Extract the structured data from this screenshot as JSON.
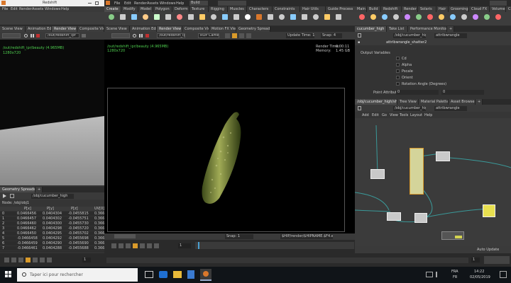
{
  "left_window": {
    "title": "Redshift",
    "menu": [
      "File",
      "Edit",
      "Render",
      "Assets",
      "Windows",
      "Help"
    ],
    "tabs": [
      "Scene View",
      "Animation Editor",
      "Render View",
      "Composite View"
    ],
    "path": "/out/redshift_ipr",
    "viewport_label": "/out/redshift_ipr/beauty (4.965MB)",
    "viewport_sub": "1280x720",
    "spreadsheet_tabs": [
      "Geometry Spreadsheet",
      "+"
    ],
    "spreadsheet_path": "/obj/cucumber_high",
    "node_label": "Node: /obj/obj1",
    "columns": [
      "",
      "P[x]",
      "P[y]",
      "P[z]",
      "UV[0]"
    ],
    "rows": [
      [
        "0",
        "0.0466456",
        "0.0404304",
        "-0.0455815",
        "0.366"
      ],
      [
        "1",
        "0.0466457",
        "0.0404302",
        "-0.0455751",
        "0.366"
      ],
      [
        "2",
        "0.0466460",
        "0.0404300",
        "-0.0455730",
        "0.366"
      ],
      [
        "3",
        "0.0466462",
        "0.0404298",
        "-0.0455720",
        "0.366"
      ],
      [
        "4",
        "0.0466450",
        "0.0404295",
        "-0.0455702",
        "0.366"
      ],
      [
        "5",
        "-0.0466458",
        "0.0404292",
        "-0.0455698",
        "0.366"
      ],
      [
        "6",
        "-0.0466459",
        "0.0404290",
        "-0.0455690",
        "0.366"
      ],
      [
        "7",
        "-0.0466461",
        "0.0404288",
        "-0.0455688",
        "0.366"
      ]
    ],
    "timeline_start": "1",
    "timeline_end": "1"
  },
  "center": {
    "menu": [
      "File",
      "Edit",
      "Render",
      "Assets",
      "Windows",
      "Help"
    ],
    "build_label": "Build",
    "shelf_tabs": [
      "Create",
      "Modify",
      "Model",
      "Polygon",
      "Deform",
      "Texture",
      "Rigging",
      "Muscles",
      "Characters",
      "Constraints",
      "Hair Utils",
      "Guide Process",
      "Terrain FX",
      "Cloud FX",
      "Volume"
    ],
    "tabs": [
      "Scene View",
      "Animation Editor",
      "Render View",
      "Composite View",
      "Motion FX View",
      "Geometry Spreadsheet"
    ],
    "path": "/out/redshift_ipr",
    "render_label": "ROP Camera",
    "update_label": "Update Time: 1",
    "snap_label": "Snap: 4",
    "viewport_label": "/out/redshift_ipr/beauty (4.965MB)",
    "viewport_sub": "1280x720",
    "render_time_label": "Render Time:",
    "render_time_value": "0:00:11",
    "memory_label": "Memory:",
    "memory_value": "1.45 GB",
    "bottom_snap": "Snap: 1",
    "bottom_path": "$HIP/render/$HIPNAME.$F4.exr",
    "frame_value": "1",
    "timeline_end": "1"
  },
  "right": {
    "tabs_top": [
      "Main",
      "Build",
      "Redshift",
      "Render",
      "Solaris",
      "Hair",
      "Grooming",
      "Cloud FX",
      "Volume",
      "Crowds",
      "Pyro FX",
      "Fluid Containers",
      "Particle Fluids",
      "Viscous Fluids",
      "Oceans",
      "FEM"
    ],
    "panel_tabs": [
      "cucumber_high",
      "Take List",
      "Performance Monitor",
      "+"
    ],
    "path": "/obj/cucumber_high",
    "node_label": "attribwrangle",
    "param_title": "attribwrangle_shatter2",
    "param_section": "Output Variables",
    "checks": [
      "Cd",
      "Alpha",
      "Pscale",
      "Orient",
      "Rotation Angle (Degrees)"
    ],
    "field1_label": "Point Attributes",
    "field1_value": "0",
    "field2_label": "Point Attributes",
    "field2_value": "0",
    "network_tabs": [
      "/obj/cucumber_high/shatter",
      "Tree View",
      "Material Palette",
      "Asset Browser",
      "+"
    ],
    "network_path": "/obj/cucumber_high",
    "network_mode": "attribwrangle",
    "network_menu": [
      "Add",
      "Edit",
      "Go",
      "View",
      "Tools",
      "Layout",
      "Help"
    ],
    "status": "Auto Update"
  },
  "taskbar": {
    "search_placeholder": "Taper ici pour rechercher",
    "lang": "FRA",
    "lang2": "FR",
    "time": "14:22",
    "date": "02/05/2019"
  },
  "colors": {
    "accent": "#d99a2a",
    "node_wire": "#3a8a8a",
    "viewport_bg": "#000000",
    "pickle": "#7f8a3a"
  }
}
